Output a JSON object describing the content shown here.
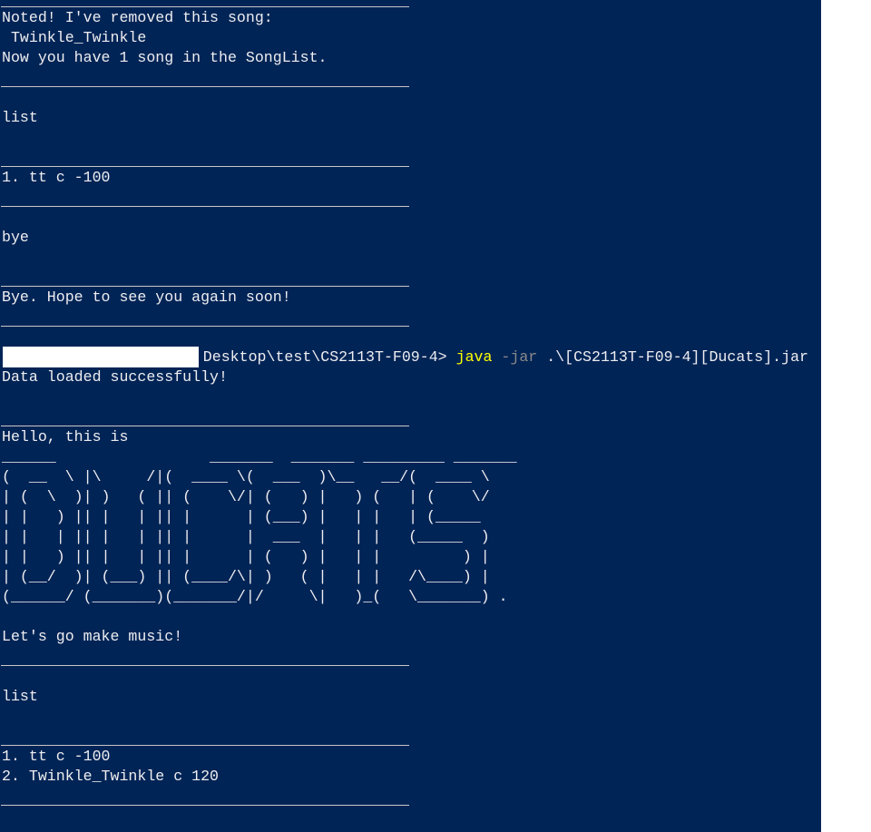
{
  "terminal": {
    "background": "#012456",
    "foreground": "#eeedf0",
    "prompt_path": "Desktop\\test\\CS2113T-F09-4> ",
    "command": "java",
    "command_param": " -jar",
    "command_arg": " .\\[CS2113T-F09-4][Ducats].jar",
    "output_lines": [
      "Noted! I've removed this song:",
      " Twinkle_Twinkle",
      "Now you have 1 song in the SongList.",
      "list",
      "1. tt c -100",
      "bye",
      "Bye. Hope to see you again soon!",
      "Data loaded successfully!",
      "Hello, this is",
      "______                 _______  _______ _________ _______",
      "(  __  \\ |\\     /|(  ____ \\(  ___  )\\__   __/(  ____ \\",
      "| (  \\  )| )   ( || (    \\/| (   ) |   ) (   | (    \\/",
      "| |   ) || |   | || |      | (___) |   | |   | (_____",
      "| |   | || |   | || |      |  ___  |   | |   (_____  )",
      "| |   ) || |   | || |      | (   ) |   | |         ) |",
      "| (__/  )| (___) || (____/\\| )   ( |   | |   /\\____) |",
      "(______/ (_______)(_______/|/     \\|   )_(   \\_______) .",
      "Let's go make music!",
      "list",
      "1. tt c -100",
      "2. Twinkle_Twinkle c 120"
    ]
  }
}
